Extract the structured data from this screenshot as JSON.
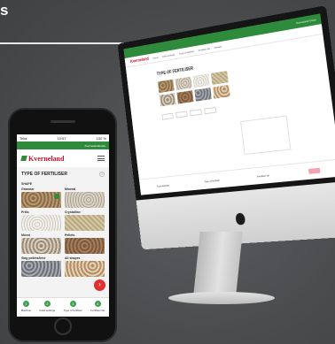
{
  "page": {
    "title_fragment": "s"
  },
  "phone": {
    "status": {
      "carrier": "Telia",
      "time": "15:57",
      "battery": "100 %"
    },
    "account_bar": "Kvernelandkunde",
    "brand": "Kverneland",
    "screen_title": "TYPE OF FERTILISER",
    "section": "SHAPE",
    "tiles": [
      {
        "label": "Granular",
        "texture": "t-gran",
        "selected": true
      },
      {
        "label": "Mineral",
        "texture": "t-min",
        "selected": false
      },
      {
        "label": "Prills",
        "texture": "t-prill",
        "selected": false
      },
      {
        "label": "Crystalline",
        "texture": "t-cry",
        "selected": false
      },
      {
        "label": "Mixed",
        "texture": "t-mix",
        "selected": false
      },
      {
        "label": "Pellets",
        "texture": "t-pel",
        "selected": false
      },
      {
        "label": "Slag pellets/lime",
        "texture": "t-slug",
        "selected": false
      },
      {
        "label": "All shapes",
        "texture": "t-all",
        "selected": false
      }
    ],
    "fab_symbol": "›",
    "bottom_nav": [
      {
        "step": "1",
        "label": "Machine"
      },
      {
        "step": "2",
        "label": "Field settings"
      },
      {
        "step": "3",
        "label": "Type of fertiliser"
      },
      {
        "step": "4",
        "label": "Fertiliser list"
      }
    ],
    "colors": {
      "brand_green": "#2e8b3c",
      "brand_red": "#c8102e",
      "fab": "#e0302f"
    }
  },
  "desktop": {
    "top_right": "Kverneland Group",
    "brand": "Kverneland",
    "nav_items": [
      "Home",
      "Field settings",
      "Type of fertiliser",
      "Fertiliser list",
      "Results"
    ],
    "heading": "TYPE OF FERTILISER",
    "tile_textures": [
      "t-gran",
      "t-min",
      "t-prill",
      "t-cry",
      "t-mix",
      "t-pel",
      "t-slug",
      "t-all"
    ],
    "bottom_items": [
      "Type settings",
      "Type of fertiliser",
      "Fertiliser list"
    ]
  }
}
